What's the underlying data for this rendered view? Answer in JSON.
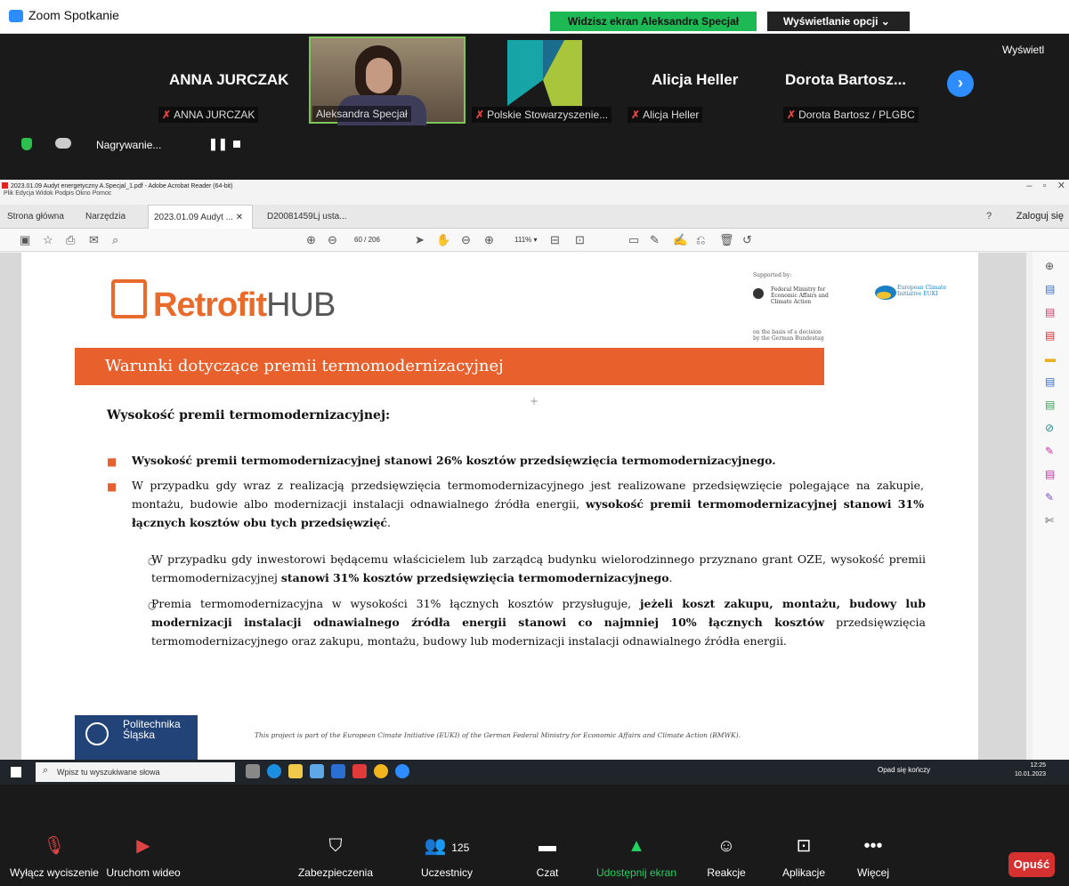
{
  "window": {
    "title": "Zoom Spotkanie",
    "share_banner": "Widzisz ekran Aleksandra Specjał",
    "view_options": "Wyświetlanie opcji ⌄",
    "gallery_view_btn": "Wyświetl"
  },
  "gallery": [
    {
      "big_name": "ANNA JURCZAK",
      "label": "ANNA JURCZAK",
      "muted": true
    },
    {
      "big_name": "",
      "label": "Aleksandra Specjał",
      "muted": false
    },
    {
      "big_name": "",
      "label": "Polskie Stowarzyszenie...",
      "muted": true
    },
    {
      "big_name": "Alicja Heller",
      "label": "Alicja Heller",
      "muted": true
    },
    {
      "big_name": "Dorota Bartosz...",
      "label": "Dorota Bartosz / PLGBC",
      "muted": true
    }
  ],
  "recording": {
    "label": "Nagrywanie..."
  },
  "reader": {
    "window_title": "2023.01.09 Audyt energetyczny A.Specjal_1.pdf - Adobe Acrobat Reader (64-bit)",
    "menu": "Plik Edycja Widok Podpis Okno Pomoc",
    "tabs": [
      "Strona główna",
      "Narzędzia",
      "2023.01.09 Audyt ...",
      "D20081459Lj usta..."
    ],
    "login": "Zaloguj się",
    "page_current": "60",
    "page_total": "/ 206",
    "zoom": "111%"
  },
  "document": {
    "logo_main": "Retrofit",
    "logo_suffix": "HUB",
    "supported_by": "Supported by:",
    "ministry": "Federal Ministry for Economic Affairs and Climate Action",
    "euki": "European Climate Initiative EUKI",
    "bundestag": "on the basis of a decision by the German Bundestag",
    "banner": "Warunki dotyczące premii termomodernizacyjnej",
    "subhead": "Wysokość premii termomodernizacyjnej:",
    "bullet1": "Wysokość premii termomodernizacyjnej stanowi 26% kosztów przedsięwzięcia termomodernizacyjnego.",
    "bullet2_a": "W przypadku gdy wraz z realizacją przedsięwzięcia termomodernizacyjnego jest realizowane przedsięwzięcie polegające na zakupie, montażu, budowie albo modernizacji instalacji odnawialnego źródła energii, ",
    "bullet2_b": "wysokość premii termomodernizacyjnej stanowi 31% łącznych kosztów obu tych przedsięwzięć",
    "sub1_a": "W przypadku gdy inwestorowi będącemu właścicielem lub zarządcą budynku wielorodzinnego przyznano grant OZE, wysokość premii termomodernizacyjnej ",
    "sub1_b": "stanowi 31% kosztów przedsięwzięcia termomodernizacyjnego",
    "sub2_a": "Premia termomodernizacyjna w wysokości 31% łącznych kosztów przysługuje, ",
    "sub2_b": "jeżeli koszt zakupu, montażu, budowy lub modernizacji instalacji odnawialnego źródła energii stanowi co najmniej 10% łącznych kosztów",
    "sub2_c": " przedsięwzięcia termomodernizacyjnego oraz zakupu, montażu, budowy lub modernizacji instalacji odnawialnego źródła energii.",
    "polsl_line1": "Politechnika",
    "polsl_line2": "Śląska",
    "footer": "This project is part of the European Cimate Initiative (EUKI) of the German Federal Ministry for Economic Affairs and Climate Action (BMWK)."
  },
  "taskbar": {
    "search_placeholder": "Wpisz tu wyszukiwane słowa",
    "weather": "Opad się kończy",
    "time": "12:25",
    "date": "10.01.2023"
  },
  "controls": {
    "mute": "Wyłącz wyciszenie",
    "video": "Uruchom wideo",
    "security": "Zabezpieczenia",
    "participants": "Uczestnicy",
    "participants_count": "125",
    "chat": "Czat",
    "share": "Udostępnij ekran",
    "reactions": "Reakcje",
    "apps": "Aplikacje",
    "more": "Więcej",
    "leave": "Opuść"
  },
  "colors": {
    "accent_orange": "#e8602c",
    "zoom_blue": "#2d8cff",
    "share_green": "#1db954",
    "leave_red": "#d53131"
  }
}
